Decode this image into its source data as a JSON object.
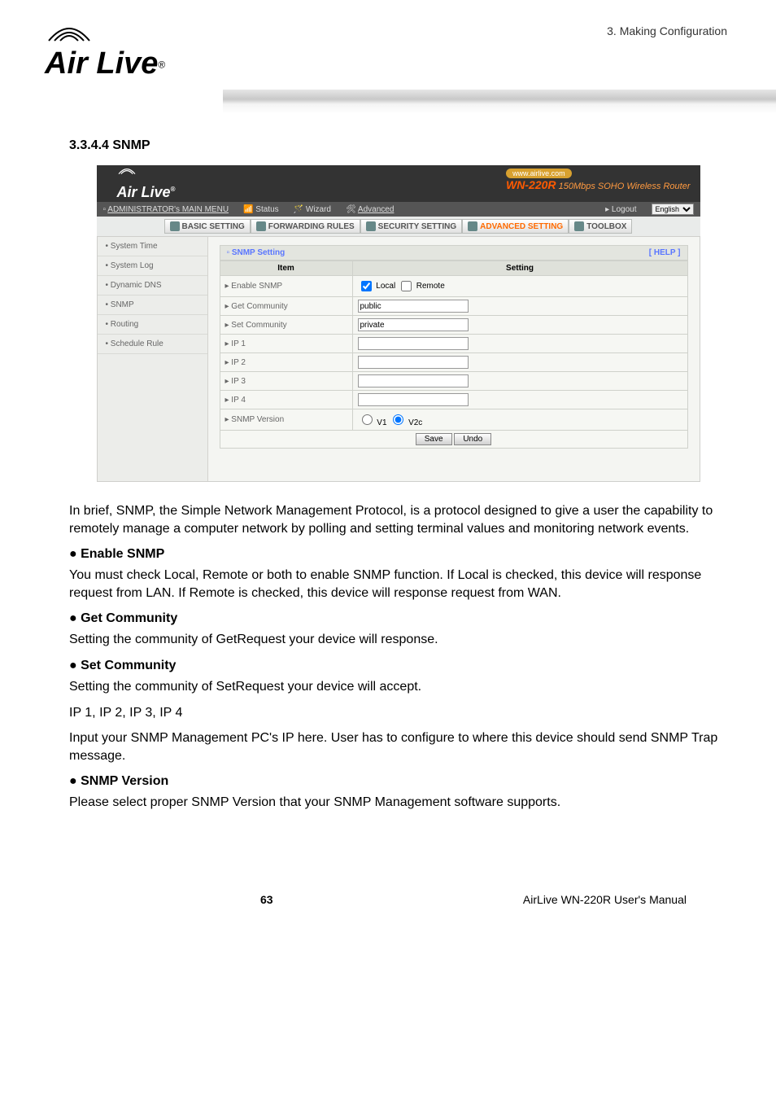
{
  "page": {
    "header_breadcrumb": "3. Making Configuration",
    "logo_text": "Air Live",
    "logo_reg": "®"
  },
  "section": {
    "number_title": "3.3.4.4  SNMP"
  },
  "ss": {
    "logo": "Air Live",
    "logo_reg": "®",
    "badge": "www.airlive.com",
    "model": "WN-220R",
    "desc": "150Mbps SOHO Wireless Router",
    "menu_main": "ADMINISTRATOR's MAIN MENU",
    "menu_status": "Status",
    "menu_wizard": "Wizard",
    "menu_advanced": "Advanced",
    "menu_logout": "▸ Logout",
    "lang_sel": "English",
    "tabs": {
      "basic": "BASIC SETTING",
      "fwd": "FORWARDING RULES",
      "sec": "SECURITY SETTING",
      "adv": "ADVANCED SETTING",
      "tool": "TOOLBOX"
    },
    "side": {
      "systime": "• System Time",
      "syslog": "• System Log",
      "ddns": "• Dynamic DNS",
      "snmp": "• SNMP",
      "routing": "• Routing",
      "sched": "• Schedule Rule"
    },
    "panel_title": "SNMP Setting",
    "help": "[ HELP ]",
    "col_item": "Item",
    "col_setting": "Setting",
    "rows": {
      "enable": "▸ Enable SNMP",
      "enable_local": "Local",
      "enable_remote": "Remote",
      "getcomm": "▸ Get Community",
      "getcomm_val": "public",
      "setcomm": "▸ Set Community",
      "setcomm_val": "private",
      "ip1": "▸ IP 1",
      "ip2": "▸ IP 2",
      "ip3": "▸ IP 3",
      "ip4": "▸ IP 4",
      "ver": "▸ SNMP Version",
      "ver_v1": "V1",
      "ver_v2c": "V2c"
    },
    "btn_save": "Save",
    "btn_undo": "Undo"
  },
  "doc": {
    "intro": "In brief, SNMP, the Simple Network Management Protocol, is a protocol designed to give a user the capability to remotely manage a computer network by polling and setting terminal values and monitoring network events.",
    "h_enable": "Enable SNMP",
    "p_enable": "You must check Local, Remote or both to enable SNMP function. If Local is checked, this device will response request from LAN. If Remote is checked, this device will response request from WAN.",
    "h_get": "Get Community",
    "p_get": "Setting the community of GetRequest your device will response.",
    "h_set": "Set Community",
    "p_set": "Setting the community of SetRequest your device will accept.",
    "p_ips": "IP 1, IP 2, IP 3, IP 4",
    "p_input": "Input your SNMP Management PC's IP here. User has to configure to where this device should send SNMP Trap message.",
    "h_ver": "SNMP Version",
    "p_ver": "Please select proper SNMP Version that your SNMP Management software supports."
  },
  "footer": {
    "page_num": "63",
    "manual": "AirLive WN-220R User's Manual"
  }
}
